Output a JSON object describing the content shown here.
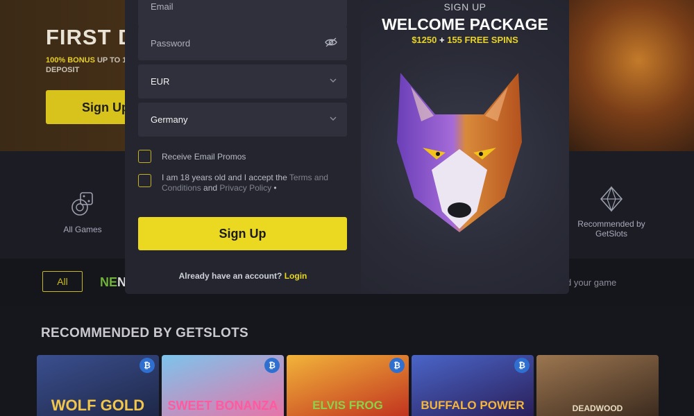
{
  "hero": {
    "title": "FIRST D",
    "subtitle_highlight": "100% BONUS",
    "subtitle_rest": " UP TO 1",
    "subtitle_line2": "DEPOSIT",
    "button": "Sign Up"
  },
  "categories": [
    {
      "label": "All Games",
      "icon": "dice-icon"
    },
    {
      "label": "Recommended by GetSlots",
      "icon": "diamond-icon"
    }
  ],
  "filters": {
    "all_label": "All",
    "provider_logo": "NE",
    "provider_logo_suffix": "N",
    "search_hint": "d your game"
  },
  "recommended": {
    "title": "RECOMMENDED BY GETSLOTS",
    "games": [
      {
        "name": "WOLF GOLD",
        "badge": "₿",
        "color": "#2b3b6a"
      },
      {
        "name": "SWEET BONANZA",
        "badge": "₿",
        "color": "#5aa6d8"
      },
      {
        "name": "ELVIS FROG",
        "badge": "₿",
        "color": "#d68a1a"
      },
      {
        "name": "BUFFALO POWER",
        "badge": "₿",
        "color": "#2a3f8a"
      },
      {
        "name": "DEADWOOD",
        "badge": "",
        "color": "#6a4a32"
      }
    ]
  },
  "modal": {
    "fields": {
      "email_placeholder": "Email",
      "password_placeholder": "Password",
      "currency_value": "EUR",
      "country_value": "Germany"
    },
    "checkboxes": {
      "promos_label": "Receive Email Promos",
      "terms_prefix": "I am 18 years old and I accept the ",
      "terms_link": "Terms and Conditions",
      "terms_and": " and ",
      "privacy_link": "Privacy Policy",
      "terms_suffix": " •"
    },
    "signup_button": "Sign Up",
    "login_prompt": "Already have an account? ",
    "login_link": "Login",
    "promo": {
      "heading": "SIGN UP",
      "title": "WELCOME PACKAGE",
      "bonus_amount": "$1250",
      "bonus_plus": " + ",
      "bonus_spins": "155 FREE SPINS"
    }
  },
  "colors": {
    "accent": "#ead920",
    "modal_bg": "#23232d",
    "field_bg": "#2f303c"
  }
}
